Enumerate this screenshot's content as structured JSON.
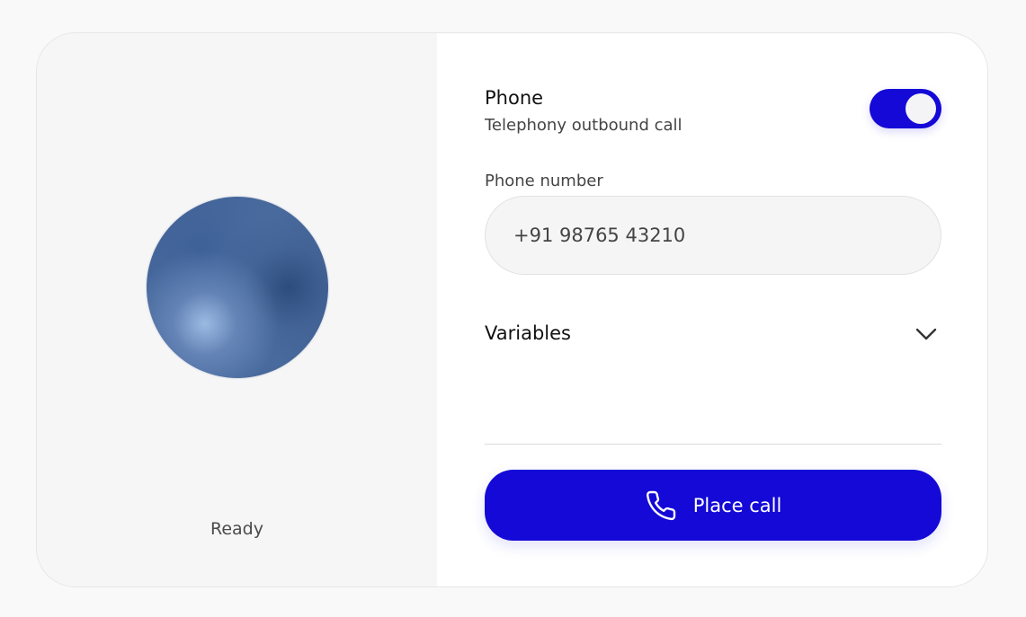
{
  "agent": {
    "status": "Ready"
  },
  "phone_panel": {
    "title": "Phone",
    "subtitle": "Telephony outbound call",
    "toggle_on": true,
    "phone_number_label": "Phone number",
    "phone_number_value": "+91 98765 43210",
    "variables_label": "Variables",
    "place_call_label": "Place call"
  },
  "icons": {
    "variables_toggle": "chevron-down-icon",
    "call": "phone-icon"
  },
  "colors": {
    "accent": "#1409d6",
    "orb": "#5679ab"
  }
}
